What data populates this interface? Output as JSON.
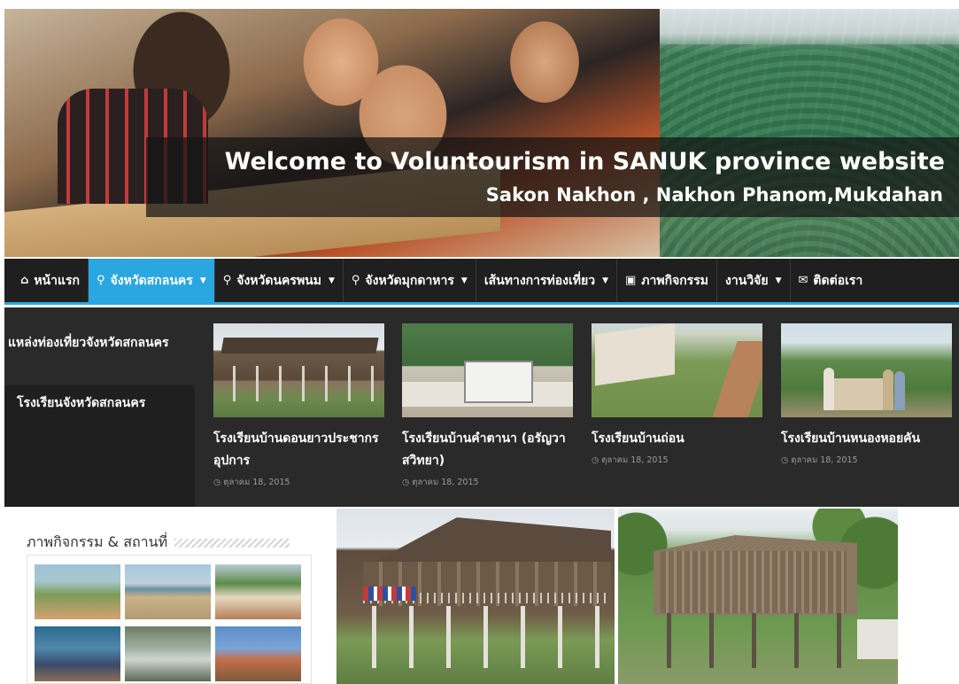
{
  "hero": {
    "title": "Welcome to Voluntourism in SANUK province website",
    "subtitle": "Sakon Nakhon , Nakhon Phanom,Mukdahan"
  },
  "nav": {
    "items": [
      {
        "label": "หน้าแรก",
        "icon": "home-icon",
        "dropdown": false
      },
      {
        "label": "จังหวัดสกลนคร",
        "icon": "map-marker-icon",
        "dropdown": true,
        "active": true
      },
      {
        "label": "จังหวัดนครพนม",
        "icon": "map-marker-icon",
        "dropdown": true
      },
      {
        "label": "จังหวัดมุกดาหาร",
        "icon": "map-marker-icon",
        "dropdown": true
      },
      {
        "label": "เส้นทางการท่องเที่ยว",
        "icon": "",
        "dropdown": true
      },
      {
        "label": "ภาพกิจกรรม",
        "icon": "image-icon",
        "dropdown": false
      },
      {
        "label": "งานวิจัย",
        "icon": "",
        "dropdown": true
      },
      {
        "label": "ติดต่อเรา",
        "icon": "chat-icon",
        "dropdown": false
      }
    ],
    "accent_color": "#2aa7e0"
  },
  "dropdown": {
    "sidebar": [
      "แหล่งท่องเที่ยวจังหวัดสกลนคร",
      "โรงเรียนจังหวัดสกลนคร"
    ],
    "cards": [
      {
        "title": "โรงเรียนบ้านดอนยาวประชากรอุปการ",
        "date": "ตุลาคม 18, 2015"
      },
      {
        "title": "โรงเรียนบ้านคำตานา (อรัญวาสวิทยา)",
        "date": "ตุลาคม 18, 2015"
      },
      {
        "title": "โรงเรียนบ้านถ่อน",
        "date": "ตุลาคม 18, 2015"
      },
      {
        "title": "โรงเรียนบ้านหนองหอยคัน",
        "date": "ตุลาคม 18, 2015"
      }
    ]
  },
  "gallery": {
    "title": "ภาพกิจกรรม & สถานที่"
  }
}
